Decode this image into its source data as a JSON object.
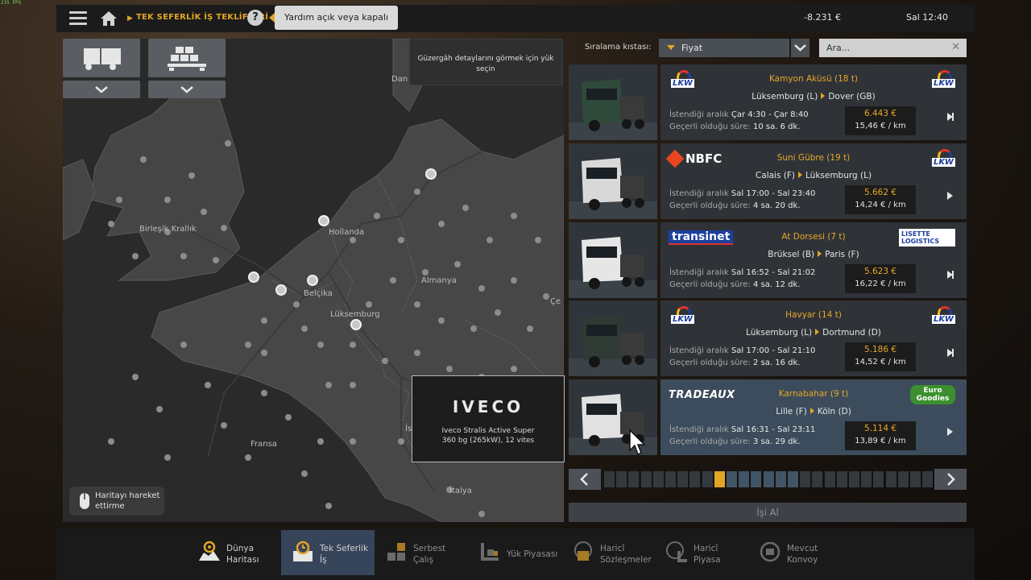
{
  "fps": "235 FPS",
  "topbar": {
    "breadcrumb": "TEK SEFERLİK İŞ TEKLİFLERİ",
    "help_symbol": "?",
    "help_tooltip": "Yardım açık veya kapalı",
    "money": "-8.231 €",
    "clock": "Sal 12:40"
  },
  "map": {
    "route_tip": "Güzergâh detaylarını görmek için yük seçin",
    "labels": {
      "uk": "Birleşik Krallık",
      "nl": "Hollanda",
      "be": "Belçika",
      "lu": "Lüksemburg",
      "de": "Almanya",
      "fr": "Fransa",
      "it": "İtalya",
      "dk": "Dan",
      "cz": "Çe",
      "at": "İs"
    },
    "truck_tip": {
      "brand": "IVECO",
      "desc1": "Iveco Stralis Active Super",
      "desc2": "360 bg (265kW), 12 vites"
    },
    "move_hint": "Haritayı hareket ettirme"
  },
  "sort": {
    "label": "Sıralama kıstası:",
    "value": "Fiyat",
    "search_placeholder": "Ara..."
  },
  "labels": {
    "interval": "İstendiği aralık",
    "validity": "Geçerli olduğu süre:"
  },
  "jobs": [
    {
      "cargo": "Kamyon Aküsü (18 t)",
      "from": "Lüksemburg (L)",
      "to": "Dover (GB)",
      "interval": "Çar 4:30 - Çar 8:40",
      "validity": "10 sa. 6 dk.",
      "price": "6.443 €",
      "perkm": "15,46 € / km",
      "logo_left": "LKW",
      "logo_right": "LKW"
    },
    {
      "cargo": "Suni Gübre (19 t)",
      "from": "Calais (F)",
      "to": "Lüksemburg (L)",
      "interval": "Sal 17:00 - Sal 23:40",
      "validity": "4 sa. 20 dk.",
      "price": "5.662 €",
      "perkm": "14,24 € / km",
      "logo_left": "NBFC",
      "logo_right": "LKW"
    },
    {
      "cargo": "At Dorsesi (7 t)",
      "from": "Brüksel (B)",
      "to": "Paris (F)",
      "interval": "Sal 16:52 - Sal 21:02",
      "validity": "4 sa. 12 dk.",
      "price": "5.623 €",
      "perkm": "16,22 € / km",
      "logo_left": "transinet",
      "logo_right": "LISETTE LOGISTICS"
    },
    {
      "cargo": "Havyar (14 t)",
      "from": "Lüksemburg (L)",
      "to": "Dortmund (D)",
      "interval": "Sal 17:00 - Sal 21:10",
      "validity": "2 sa. 16 dk.",
      "price": "5.186 €",
      "perkm": "14,52 € / km",
      "logo_left": "LKW",
      "logo_right": "LKW"
    },
    {
      "cargo": "Karnabahar (9 t)",
      "from": "Lille (F)",
      "to": "Köln (D)",
      "interval": "Sal 16:31 - Sal 23:11",
      "validity": "3 sa. 29 dk.",
      "price": "5.114 €",
      "perkm": "13,89 € / km",
      "logo_left": "TRADEAUX",
      "logo_right": "Euro Goodies"
    }
  ],
  "pager": {
    "current_page": 10,
    "total_pages": 27
  },
  "accept_label": "İşi Al",
  "bottom_nav": [
    {
      "l1": "Dünya",
      "l2": "Haritası",
      "icon": "world-map-icon"
    },
    {
      "l1": "Tek Seferlik",
      "l2": "İş",
      "icon": "clock-job-icon"
    },
    {
      "l1": "Serbest",
      "l2": "Çalış",
      "icon": "freight-boxes-icon"
    },
    {
      "l1": "Yük Piyasası",
      "l2": "",
      "icon": "cargo-market-icon"
    },
    {
      "l1": "Haricî",
      "l2": "Sözleşmeler",
      "icon": "external-contracts-icon"
    },
    {
      "l1": "Haricî",
      "l2": "Piyasa",
      "icon": "external-market-icon"
    },
    {
      "l1": "Mevcut",
      "l2": "Konvoy",
      "icon": "convoy-icon"
    }
  ],
  "colors": {
    "accent": "#e3a524",
    "selected_row": "#3c4c5c",
    "active_nav": "#37455a"
  }
}
